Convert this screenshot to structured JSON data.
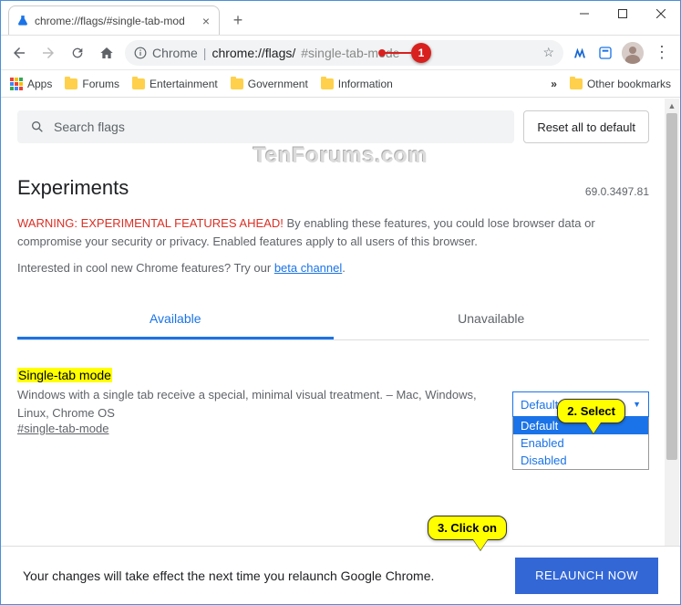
{
  "window": {
    "tab_title": "chrome://flags/#single-tab-mod"
  },
  "omnibox": {
    "label": "Chrome",
    "url_path": "chrome://flags/",
    "url_fragment": "#single-tab-mode"
  },
  "bookmarks": {
    "apps": "Apps",
    "items": [
      "Forums",
      "Entertainment",
      "Government",
      "Information"
    ],
    "other": "Other bookmarks"
  },
  "search": {
    "placeholder": "Search flags",
    "reset_label": "Reset all to default"
  },
  "page": {
    "title": "Experiments",
    "version": "69.0.3497.81",
    "warning_head": "WARNING: EXPERIMENTAL FEATURES AHEAD!",
    "warning_body": "By enabling these features, you could lose browser data or compromise your security or privacy. Enabled features apply to all users of this browser.",
    "beta_prefix": "Interested in cool new Chrome features? Try our ",
    "beta_link": "beta channel",
    "tabs": {
      "available": "Available",
      "unavailable": "Unavailable"
    }
  },
  "flag": {
    "title": "Single-tab mode",
    "description": "Windows with a single tab receive a special, minimal visual treatment. – Mac, Windows, Linux, Chrome OS",
    "hash": "#single-tab-mode",
    "selected": "Default",
    "options": [
      "Default",
      "Enabled",
      "Disabled"
    ]
  },
  "relaunch": {
    "message": "Your changes will take effect the next time you relaunch Google Chrome.",
    "button": "RELAUNCH NOW"
  },
  "annotations": {
    "step1": "1",
    "step2": "2. Select",
    "step3": "3. Click on"
  },
  "watermark": "TenForums.com"
}
